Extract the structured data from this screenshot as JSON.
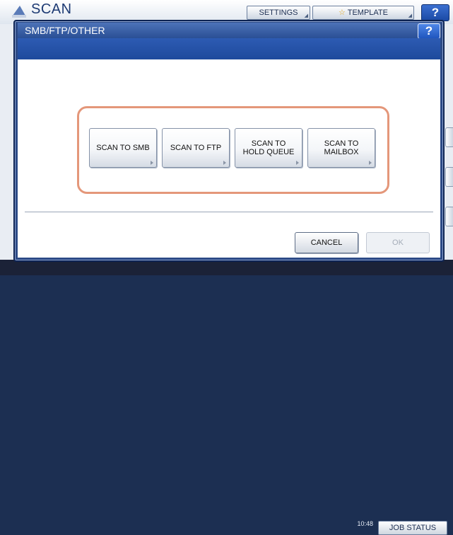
{
  "background_app": {
    "title": "SCAN",
    "settings_label": "SETTINGS",
    "template_label": "TEMPLATE",
    "help_label": "?",
    "datetime_line1": "",
    "datetime_line2": "10:48",
    "job_status_label": "JOB STATUS"
  },
  "dialog": {
    "title": "SMB/FTP/OTHER",
    "help_label": "?",
    "destinations": [
      {
        "label": "SCAN TO SMB"
      },
      {
        "label": "SCAN TO FTP"
      },
      {
        "label": "SCAN TO\nHOLD QUEUE"
      },
      {
        "label": "SCAN TO\nMAILBOX"
      }
    ],
    "cancel_label": "CANCEL",
    "ok_label": "OK"
  },
  "colors": {
    "highlight_frame": "#e4977a",
    "title_band": "#2d5bb3"
  }
}
